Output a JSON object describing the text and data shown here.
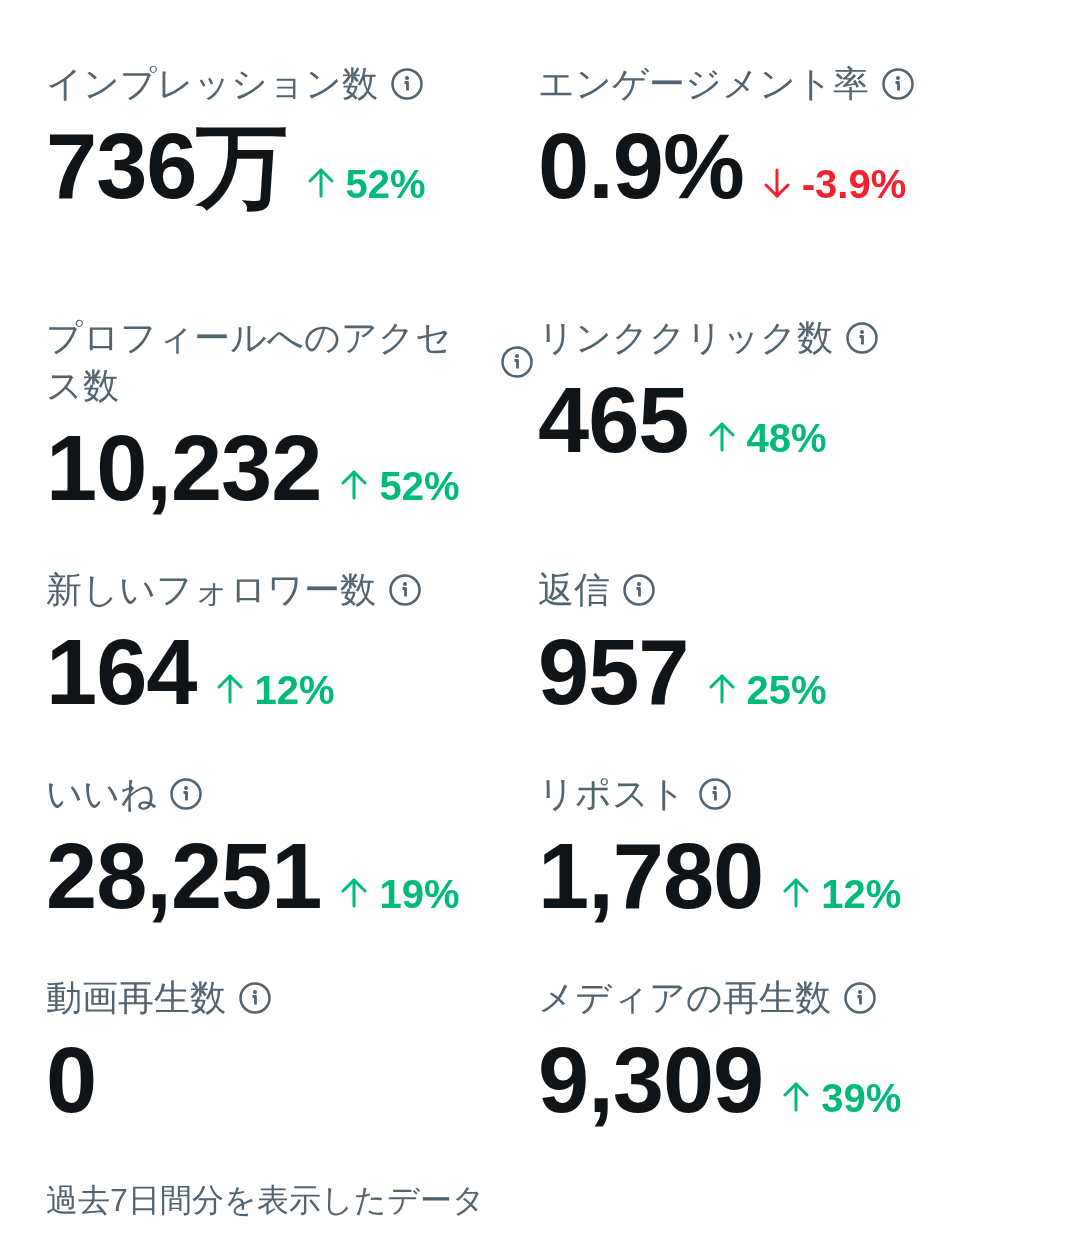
{
  "metrics": [
    {
      "label": "インプレッション数",
      "value": "736万",
      "change": {
        "kind": "increase",
        "text": "52%"
      }
    },
    {
      "label": "エンゲージメント率",
      "value": "0.9%",
      "change": {
        "kind": "decrease",
        "text": "-3.9%"
      }
    },
    {
      "label": "プロフィールへのアクセス数",
      "value": "10,232",
      "change": {
        "kind": "increase",
        "text": "52%"
      }
    },
    {
      "label": "リンククリック数",
      "value": "465",
      "change": {
        "kind": "increase",
        "text": "48%"
      }
    },
    {
      "label": "新しいフォロワー数",
      "value": "164",
      "change": {
        "kind": "increase",
        "text": "12%"
      }
    },
    {
      "label": "返信",
      "value": "957",
      "change": {
        "kind": "increase",
        "text": "25%"
      }
    },
    {
      "label": "いいね",
      "value": "28,251",
      "change": {
        "kind": "increase",
        "text": "19%"
      }
    },
    {
      "label": "リポスト",
      "value": "1,780",
      "change": {
        "kind": "increase",
        "text": "12%"
      }
    },
    {
      "label": "動画再生数",
      "value": "0"
    },
    {
      "label": "メディアの再生数",
      "value": "9,309",
      "change": {
        "kind": "increase",
        "text": "39%"
      }
    }
  ],
  "footnote": "過去7日間分を表示したデータ"
}
